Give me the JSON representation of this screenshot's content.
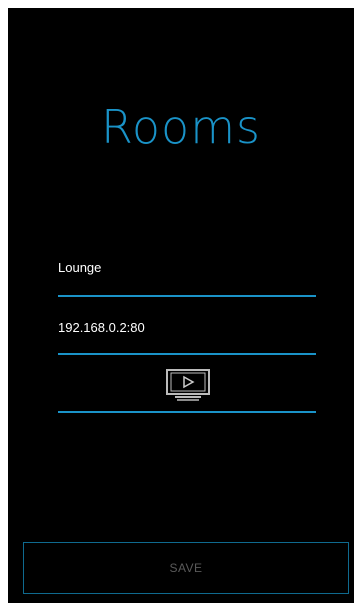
{
  "header": {
    "title": "Rooms"
  },
  "form": {
    "room_name": "Lounge",
    "address": "192.168.0.2:80",
    "device_icon": "tv-play-icon"
  },
  "footer": {
    "save_label": "SAVE"
  },
  "colors": {
    "background": "#000000",
    "accent": "#1a93c8",
    "text": "#ffffff",
    "button_text": "#5a5a5a"
  }
}
